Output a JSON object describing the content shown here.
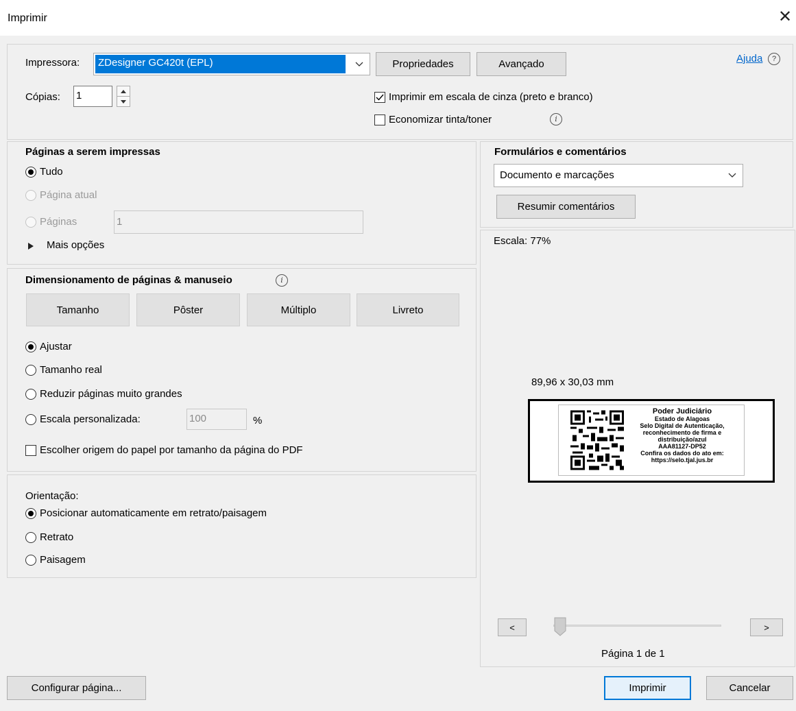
{
  "window": {
    "title": "Imprimir",
    "close_glyph": "✕"
  },
  "printer": {
    "label": "Impressora:",
    "selected": "ZDesigner GC420t (EPL)",
    "properties_button": "Propriedades",
    "advanced_button": "Avançado",
    "help_link": "Ajuda",
    "copies_label": "Cópias:",
    "copies_value": "1",
    "grayscale_label": "Imprimir em escala de cinza (preto e branco)",
    "grayscale_checked": true,
    "save_ink_label": "Economizar tinta/toner",
    "save_ink_checked": false
  },
  "pages": {
    "heading": "Páginas a serem impressas",
    "all": "Tudo",
    "current": "Página atual",
    "pages": "Páginas",
    "pages_value": "1",
    "more_options": "Mais opções"
  },
  "sizing": {
    "heading": "Dimensionamento de páginas & manuseio",
    "tabs": [
      "Tamanho",
      "Pôster",
      "Múltiplo",
      "Livreto"
    ],
    "fit": "Ajustar",
    "actual": "Tamanho real",
    "shrink": "Reduzir páginas muito grandes",
    "custom": "Escala personalizada:",
    "custom_value": "100",
    "percent": "%",
    "paper_source": "Escolher origem do papel por tamanho da página do PDF"
  },
  "orientation": {
    "heading": "Orientação:",
    "auto": "Posicionar automaticamente em retrato/paisagem",
    "portrait": "Retrato",
    "landscape": "Paisagem"
  },
  "forms": {
    "heading": "Formulários e comentários",
    "selected": "Documento e marcações",
    "summarize_button": "Resumir comentários"
  },
  "preview": {
    "scale": "Escala: 77%",
    "dimensions": "89,96 x 30,03 mm",
    "label_lines": [
      "Poder Judiciário",
      "Estado de Alagoas",
      "Selo Digital de Autenticação,",
      "reconhecimento de firma e",
      "distribuição/azul",
      "AAA81127-DP52",
      "Confira os dados do ato em:",
      "https://selo.tjal.jus.br"
    ],
    "prev_button": "<",
    "next_button": ">",
    "page_indicator": "Página 1 de 1"
  },
  "footer": {
    "page_setup_button": "Configurar página...",
    "print_button": "Imprimir",
    "cancel_button": "Cancelar"
  },
  "colors": {
    "accent": "#0078d7",
    "highlight": "#0078d7",
    "link": "#0066cc"
  },
  "icons": {
    "close": "close-icon",
    "help": "help-icon",
    "info": "info-icon",
    "dropdown": "chevron-down-icon",
    "expand": "triangle-right-icon",
    "qr": "qr-code-icon"
  }
}
